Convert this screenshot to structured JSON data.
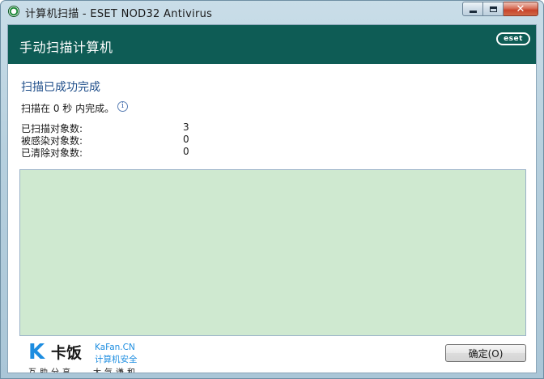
{
  "window": {
    "title": "计算机扫描 - ESET NOD32 Antivirus",
    "controls": {
      "minimize": "minimize-icon",
      "maximize": "maximize-icon",
      "close": "close-icon"
    }
  },
  "header": {
    "title": "手动扫描计算机",
    "logo": "eset",
    "background": "#0e5c55"
  },
  "result": {
    "status": "扫描已成功完成",
    "time_message": "扫描在 0 秒 内完成。",
    "info_icon": "i"
  },
  "stats": [
    {
      "label": "已扫描对象数:",
      "value": "3"
    },
    {
      "label": "被感染对象数:",
      "value": "0"
    },
    {
      "label": "已清除对象数:",
      "value": "0"
    }
  ],
  "log": {
    "background": "#cfe9d0"
  },
  "watermark": {
    "k": "K",
    "brand": "卡饭",
    "site": "KaFan.CN",
    "tagline": "计算机安全",
    "slogan_left": "互助分享",
    "slogan_right": "大气谦和"
  },
  "footer": {
    "ok_label": "确定(O)"
  }
}
